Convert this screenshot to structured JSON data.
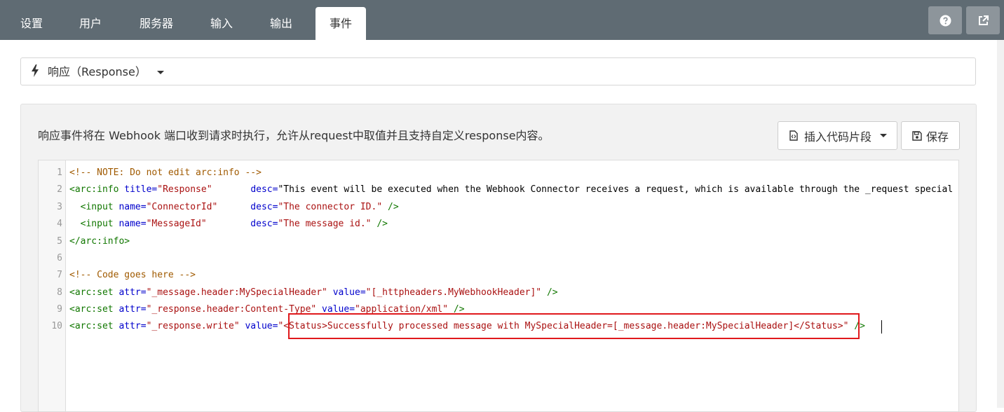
{
  "tabs": [
    {
      "label": "设置"
    },
    {
      "label": "用户"
    },
    {
      "label": "服务器"
    },
    {
      "label": "输入"
    },
    {
      "label": "输出"
    },
    {
      "label": "事件"
    }
  ],
  "topbar_buttons": {
    "help_icon": "question-circle-icon",
    "external_icon": "external-link-icon"
  },
  "event_select": {
    "value": "响应（Response）"
  },
  "description": "响应事件将在 Webhook 端口收到请求时执行，允许从request中取值并且支持自定义response内容。",
  "actions": {
    "insert_snippet": "插入代码片段",
    "save": "保存"
  },
  "editor": {
    "line_numbers": [
      "1",
      "2",
      "3",
      "4",
      "5",
      "6",
      "7",
      "8",
      "9",
      "10"
    ],
    "lines": [
      "<!-- NOTE: Do not edit arc:info -->",
      "<arc:info title=\"Response\"       desc=\"This event will be executed when the Webhook Connector receives a request, which is available through the _request special",
      "  <input name=\"ConnectorId\"      desc=\"The connector ID.\" />",
      "  <input name=\"MessageId\"        desc=\"The message id.\" />",
      "</arc:info>",
      "",
      "<!-- Code goes here -->",
      "<arc:set attr=\"_message.header:MySpecialHeader\" value=\"[_httpheaders.MyWebhookHeader]\" />",
      "<arc:set attr=\"_response.header:Content-Type\" value=\"application/xml\" />",
      "<arc:set attr=\"_response.write\" value=\"<Status>Successfully processed message with MySpecialHeader=[_message.header:MySpecialHeader]</Status>\" />"
    ]
  },
  "colors": {
    "topbar": "#5f6b73",
    "highlight_box": "#e0191c",
    "comment": "#a05a00",
    "tag": "#117700",
    "attribute": "#0000cc",
    "string": "#aa1111"
  }
}
